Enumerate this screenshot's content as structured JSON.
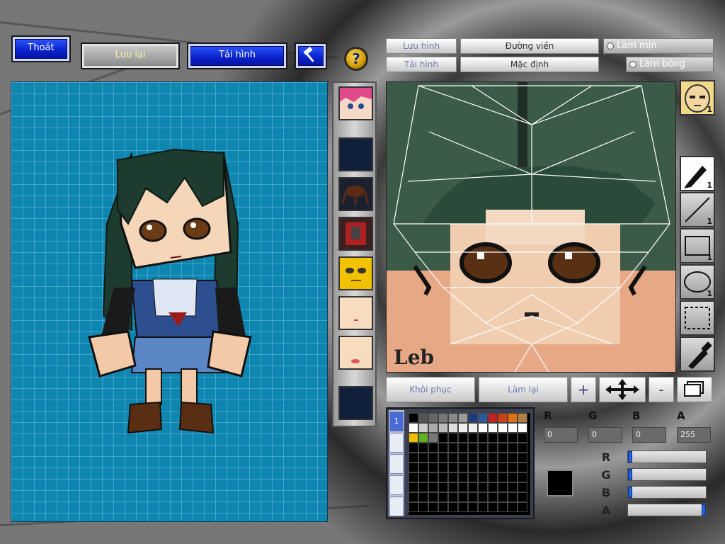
{
  "toolbar": {
    "exit_label": "Thoát",
    "save_label": "Lưu lại",
    "reload_label": "Tải hình",
    "help_glyph": "?",
    "hammer_icon": "hammer-icon"
  },
  "editor_top": {
    "save_label": "Lưu hình",
    "load_label": "Tải hình",
    "outline_label": "Đường viền",
    "default_label": "Mặc định",
    "smooth_label": "Làm mịn",
    "shade_label": "Làm bóng"
  },
  "parts": {
    "slots": [
      "hair-part",
      "empty-slot",
      "body-part",
      "armor-part",
      "face-yellow",
      "face-skin",
      "face-skin-blush",
      "empty-slot"
    ]
  },
  "canvas": {
    "signature": "Leb"
  },
  "tools": {
    "brush_count": "1",
    "line_count": "1",
    "rect_count": "1",
    "ellipse_count": "1",
    "avatar_count": "1"
  },
  "actions": {
    "restore_label": "Khôi phục",
    "redo_label": "Làm lại",
    "plus_glyph": "+",
    "minus_glyph": "-"
  },
  "palette": {
    "tab_label": "1",
    "colors": [
      "#000000",
      "#555555",
      "#666666",
      "#777777",
      "#888888",
      "#999999",
      "#1a3a7a",
      "#2c5aa0",
      "#c02020",
      "#d04010",
      "#e07010",
      "#b08040",
      "#ffffff",
      "#cccccc",
      "#aaaaaa",
      "#bbbbbb",
      "#dddddd",
      "#eeeeee",
      "#f0f0f0",
      "#ffffff",
      "#ffffff",
      "#ffffff",
      "#ffffff",
      "#ffffff",
      "#f0c000",
      "#60b020",
      "#777777"
    ]
  },
  "color": {
    "r_label": "R",
    "g_label": "G",
    "b_label": "B",
    "a_label": "A",
    "r_value": "0",
    "g_value": "0",
    "b_value": "0",
    "a_value": "255",
    "current": "#000000",
    "r_slider": 0,
    "g_slider": 0,
    "b_slider": 0,
    "a_slider": 1
  }
}
